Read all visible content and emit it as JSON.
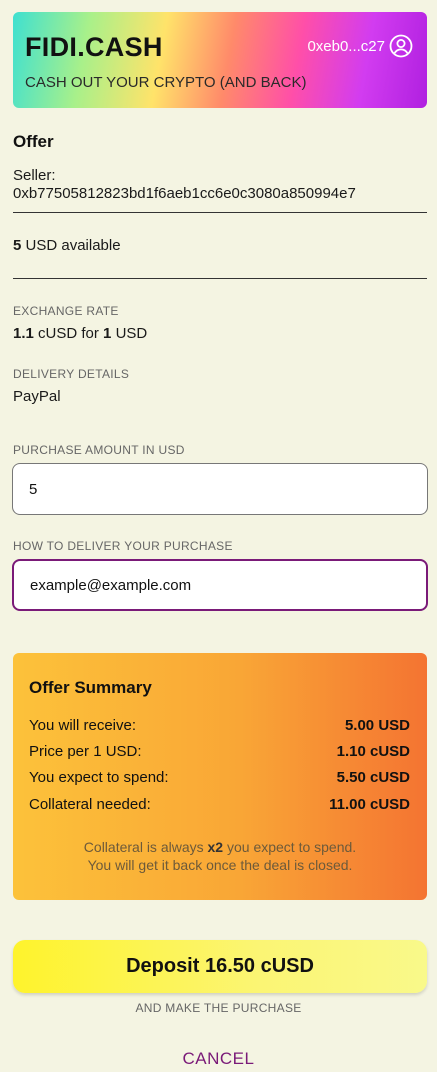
{
  "header": {
    "brand": "FIDI.CASH",
    "tagline": "CASH OUT YOUR CRYPTO (AND BACK)",
    "wallet": "0xeb0...c27",
    "account_icon": "account-circle-icon"
  },
  "offer": {
    "title": "Offer",
    "seller_label": "Seller:",
    "seller_address": "0xb77505812823bd1f6aeb1cc6e0c3080a850994e7",
    "available_amount": "5",
    "available_text": "USD available",
    "exchange_rate_label": "EXCHANGE RATE",
    "rate_value": "1.1",
    "rate_mid": "cUSD for",
    "rate_base": "1",
    "rate_unit": "USD",
    "delivery_label": "DELIVERY DETAILS",
    "delivery_value": "PayPal"
  },
  "form": {
    "amount_label": "PURCHASE AMOUNT IN USD",
    "amount_value": "5",
    "deliver_label": "HOW TO DELIVER YOUR PURCHASE",
    "deliver_value": "example@example.com"
  },
  "summary": {
    "title": "Offer Summary",
    "rows": [
      {
        "label": "You will receive:",
        "value": "5.00 USD"
      },
      {
        "label": "Price per 1 USD:",
        "value": "1.10 cUSD"
      },
      {
        "label": "You expect to spend:",
        "value": "5.50 cUSD"
      },
      {
        "label": "Collateral needed:",
        "value": "11.00 cUSD"
      }
    ],
    "note_pre": "Collateral is always",
    "note_bold": "x2",
    "note_post": "you expect to spend.",
    "note_line2": "You will get it back once the deal is closed."
  },
  "actions": {
    "deposit_label": "Deposit 16.50 cUSD",
    "deposit_sub": "AND MAKE THE PURCHASE",
    "cancel_label": "CANCEL"
  },
  "colors": {
    "background": "#f4f4e2",
    "accent": "#7a1a78",
    "deposit": "#fef32c"
  }
}
